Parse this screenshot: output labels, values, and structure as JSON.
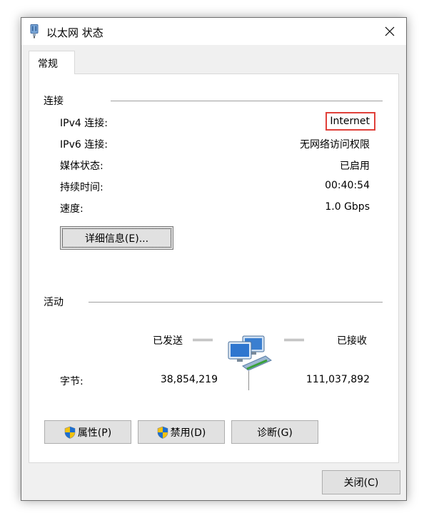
{
  "window": {
    "title": "以太网 状态",
    "close_symbol": "✕"
  },
  "tabs": [
    {
      "label": "常规",
      "selected": true
    }
  ],
  "connection": {
    "section_title": "连接",
    "rows": [
      {
        "label": "IPv4 连接:",
        "value": "Internet",
        "highlighted": true
      },
      {
        "label": "IPv6 连接:",
        "value": "无网络访问权限"
      },
      {
        "label": "媒体状态:",
        "value": "已启用"
      },
      {
        "label": "持续时间:",
        "value": "00:40:54"
      },
      {
        "label": "速度:",
        "value": "1.0 Gbps"
      }
    ],
    "details_button": "详细信息(E)..."
  },
  "activity": {
    "section_title": "活动",
    "sent_label": "已发送",
    "received_label": "已接收",
    "bytes_label": "字节:",
    "bytes_sent": "38,854,219",
    "bytes_received": "111,037,892"
  },
  "buttons": {
    "properties": "属性(P)",
    "disable": "禁用(D)",
    "diagnose": "诊断(G)",
    "close": "关闭(C)"
  },
  "colors": {
    "highlight_border": "#e0403a",
    "window_bg": "#f0f0f0",
    "panel_bg": "#ffffff",
    "button_bg": "#e1e1e1"
  },
  "icons": {
    "title": "network-adapter-icon",
    "network": "network-computers-icon",
    "shield": "uac-shield-icon"
  }
}
